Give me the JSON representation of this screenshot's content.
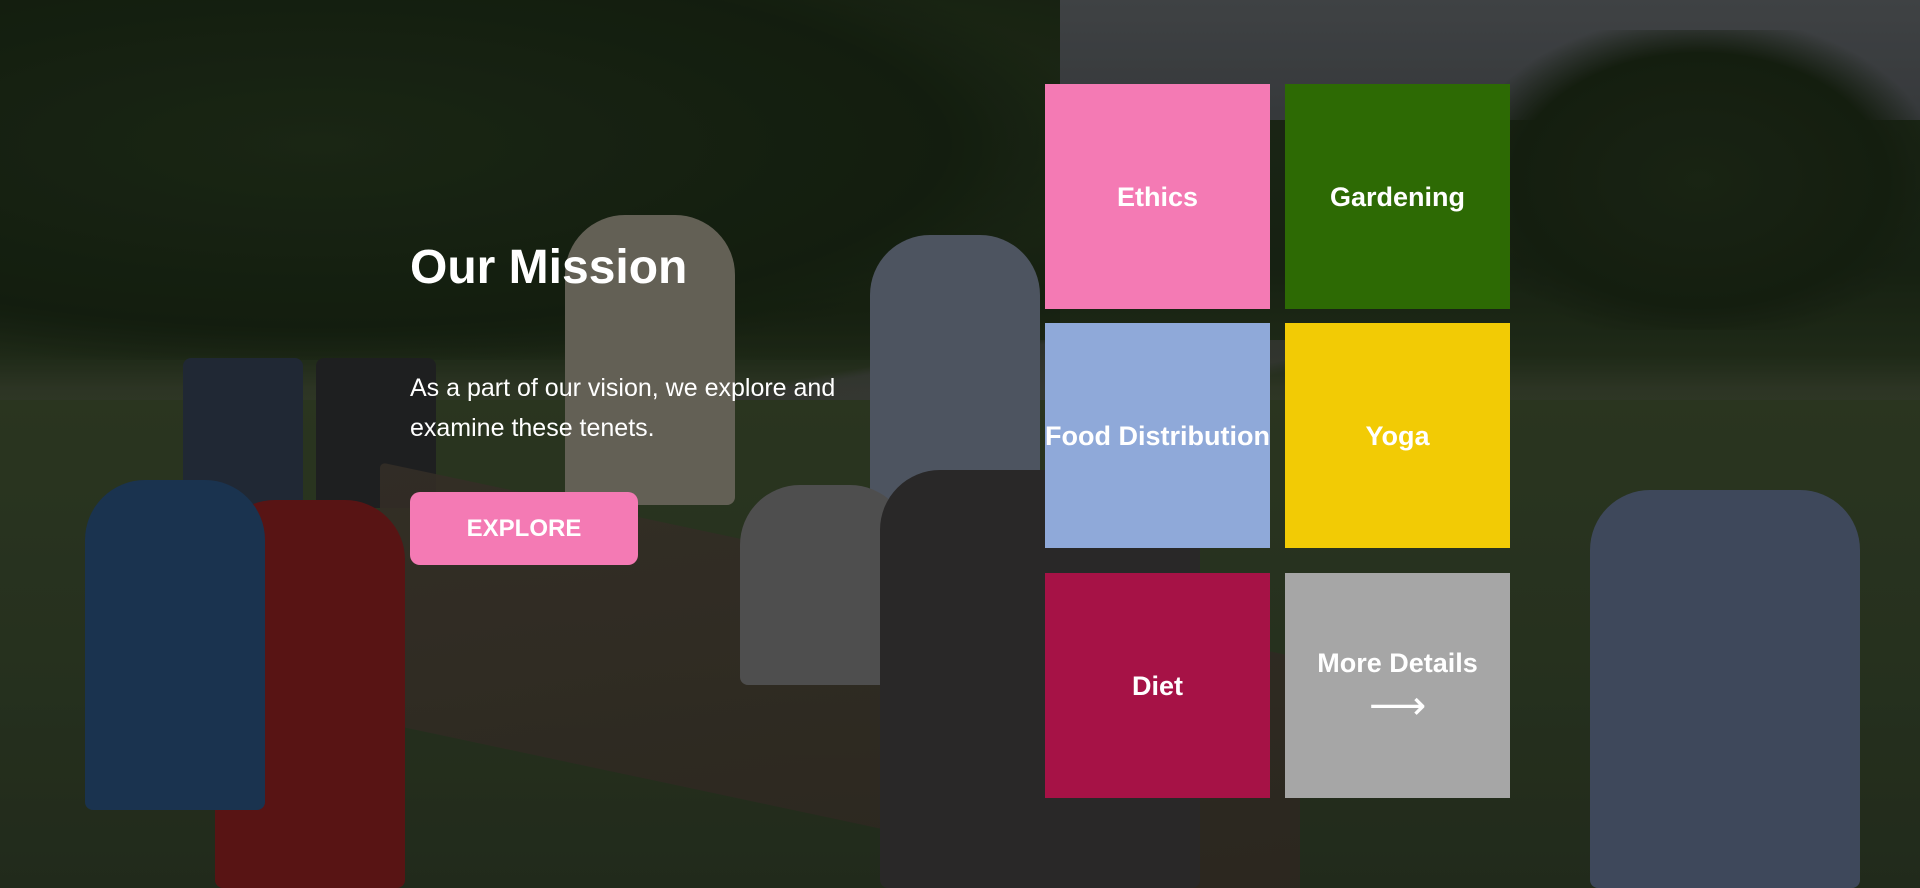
{
  "mission": {
    "title": "Our Mission",
    "description": "As a part of our vision, we explore and examine these tenets.",
    "explore_label": "EXPLORE"
  },
  "tiles": [
    {
      "label": "Ethics",
      "color": "#f47ab4"
    },
    {
      "label": "Gardening",
      "color": "#2d6a04"
    },
    {
      "label": "Food Distribution",
      "color": "#8fa9d9"
    },
    {
      "label": "Yoga",
      "color": "#f2cb05"
    },
    {
      "label": "Diet",
      "color": "#a61246"
    },
    {
      "label": "More Details",
      "color": "#a6a6a6",
      "icon": "arrow-right-icon",
      "arrow_glyph": "⟶"
    }
  ],
  "colors": {
    "accent": "#f47ab4",
    "text": "#ffffff"
  }
}
